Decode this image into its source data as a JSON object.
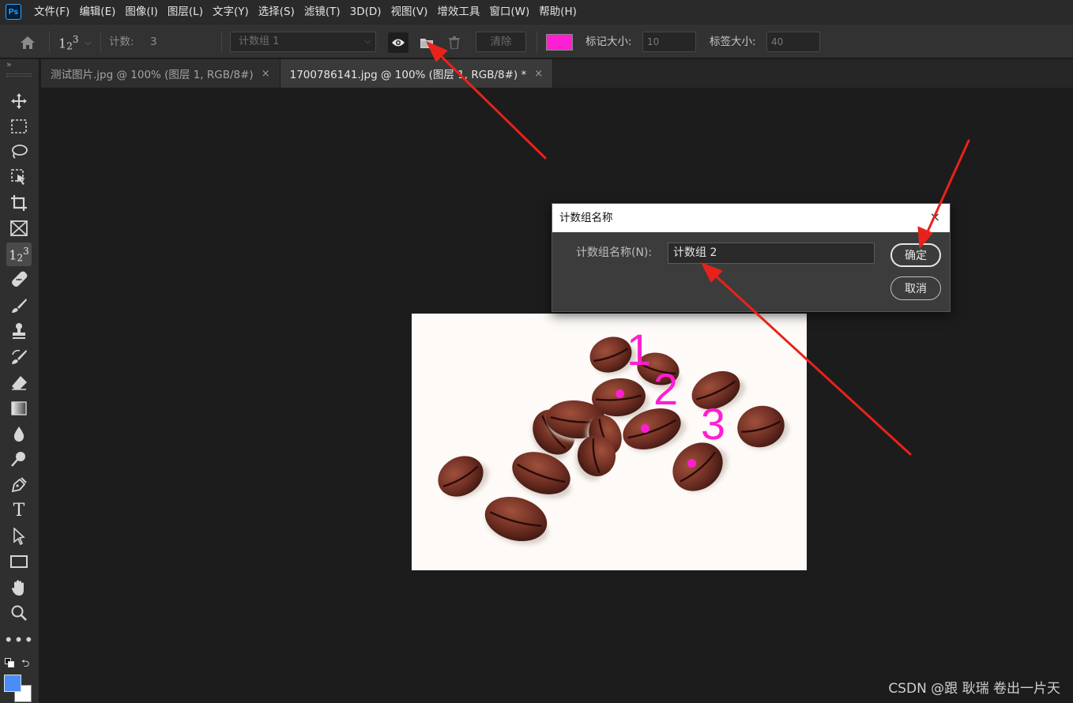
{
  "app": {
    "logo_text": "Ps"
  },
  "menu": [
    "文件(F)",
    "编辑(E)",
    "图像(I)",
    "图层(L)",
    "文字(Y)",
    "选择(S)",
    "滤镜(T)",
    "3D(D)",
    "视图(V)",
    "增效工具",
    "窗口(W)",
    "帮助(H)"
  ],
  "options": {
    "tool_glyph": "123",
    "count_label": "计数:",
    "count_value": "3",
    "group_select": "计数组 1",
    "clear_label": "清除",
    "marker_color": "#ff1ed2",
    "marker_size_label": "标记大小:",
    "marker_size_value": "10",
    "label_size_label": "标签大小:",
    "label_size_value": "40"
  },
  "tabs": [
    {
      "label": "测试图片.jpg @ 100% (图层 1, RGB/8#)",
      "close": "×",
      "active": false
    },
    {
      "label": "1700786141.jpg @ 100% (图层 1, RGB/8#) *",
      "close": "×",
      "active": true
    }
  ],
  "tools": [
    "move-icon",
    "marquee-icon",
    "lasso-icon",
    "object-select-icon",
    "crop-icon",
    "frame-icon",
    "count-icon",
    "healing-icon",
    "brush-icon",
    "stamp-icon",
    "history-brush-icon",
    "eraser-icon",
    "gradient-icon",
    "blur-icon",
    "dodge-icon",
    "pen-icon",
    "type-icon",
    "path-select-icon",
    "rectangle-icon",
    "hand-icon",
    "zoom-icon",
    "more-icon"
  ],
  "colors": {
    "foreground": "#4a8df5",
    "background": "#ffffff",
    "accent_arrow": "#e8221b",
    "count_marker": "#ff1ed2"
  },
  "dialog": {
    "title": "计数组名称",
    "close": "×",
    "field_label": "计数组名称(N):",
    "field_value": "计数组 2",
    "ok_label": "确定",
    "cancel_label": "取消"
  },
  "image_counts": [
    "1",
    "2",
    "3"
  ],
  "watermark": "CSDN @跟 耿瑞 卷出一片天"
}
